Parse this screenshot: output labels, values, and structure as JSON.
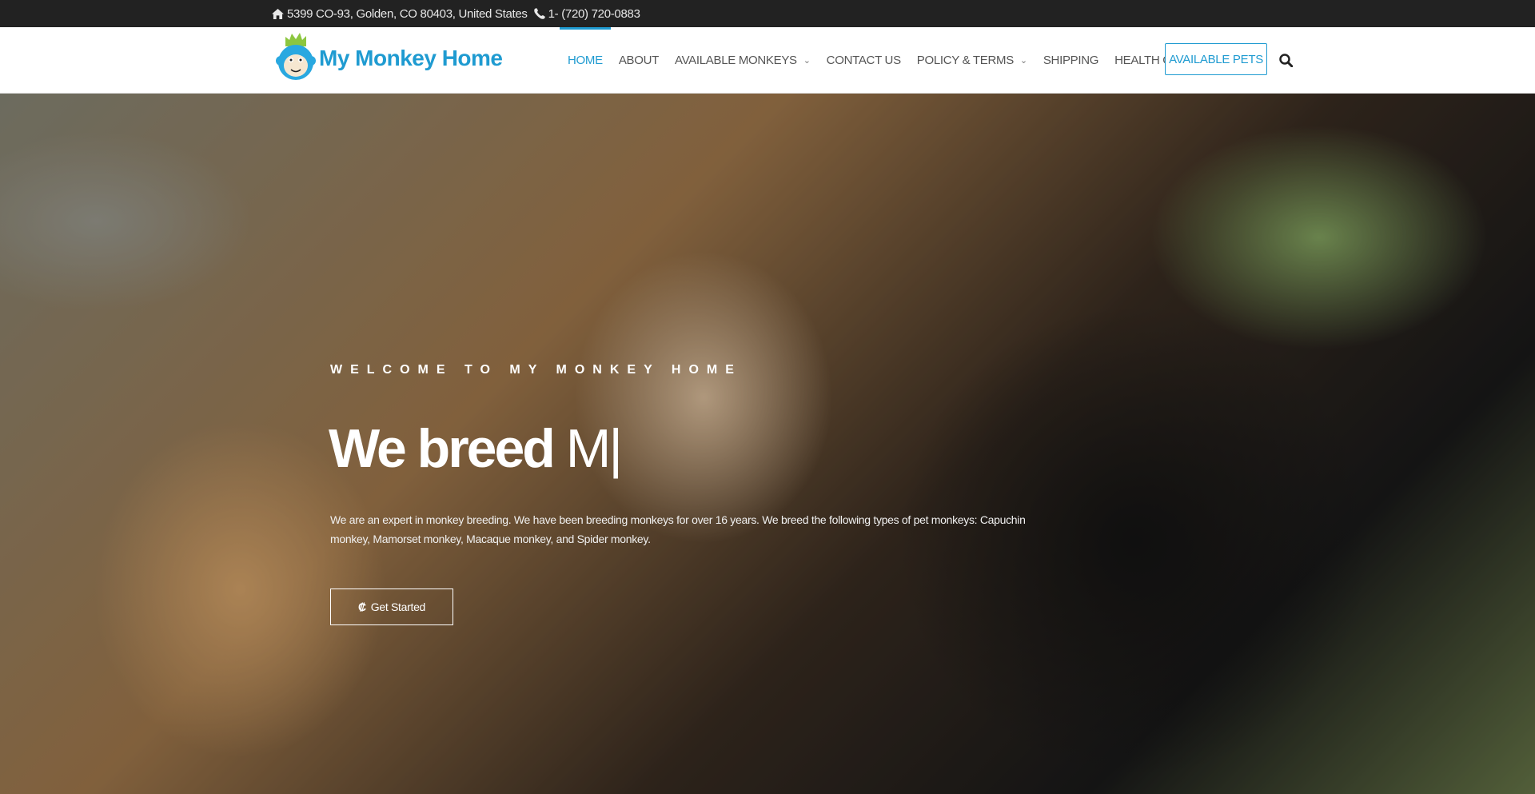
{
  "topbar": {
    "address": "5399 CO-93, Golden, CO 80403, United States",
    "phone": "1- (720) 720-0883"
  },
  "header": {
    "logo_text": "My Monkey Home",
    "nav": [
      {
        "label": "HOME",
        "active": true,
        "dropdown": false
      },
      {
        "label": "ABOUT",
        "active": false,
        "dropdown": false
      },
      {
        "label": "AVAILABLE MONKEYS",
        "active": false,
        "dropdown": true
      },
      {
        "label": "CONTACT US",
        "active": false,
        "dropdown": false
      },
      {
        "label": "POLICY & TERMS",
        "active": false,
        "dropdown": true
      },
      {
        "label": "SHIPPING",
        "active": false,
        "dropdown": false
      },
      {
        "label": "HEALTH GUARANTEE",
        "active": false,
        "dropdown": false
      }
    ],
    "icons": [
      "menu-icon",
      "search-icon"
    ],
    "cta_label": "AVAILABLE PETS"
  },
  "hero": {
    "kicker": "WELCOME TO MY MONKEY HOME",
    "title_strong": "We breed",
    "title_typed": "M|",
    "text": "We are an expert in monkey breeding. We have been breeding monkeys for over 16 years. We breed the following types of pet monkeys: Capuchin monkey, Mamorset monkey, Macaque monkey, and Spider monkey.",
    "button_label": "Get Started",
    "button_icon": "chevron-c-icon"
  },
  "colors": {
    "accent": "#1f9bd1",
    "topbar_bg": "#222222",
    "header_bg": "#ffffff"
  }
}
